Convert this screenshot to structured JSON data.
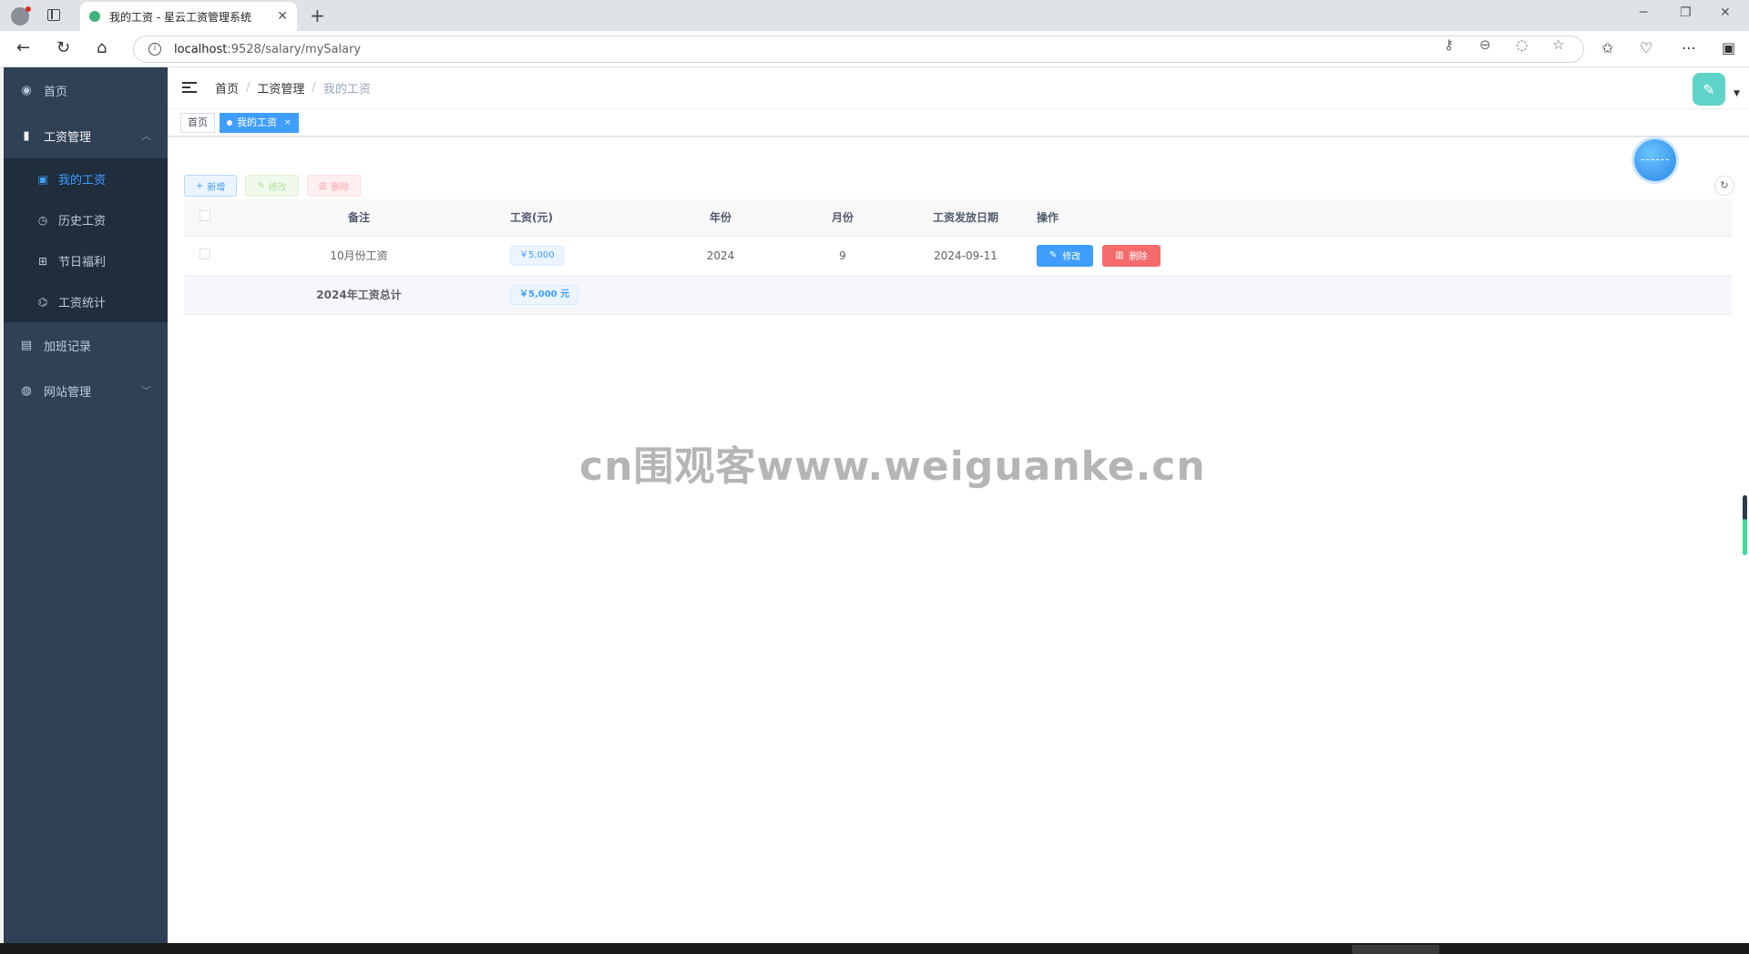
{
  "browser": {
    "tab_title": "我的工资 - 星云工资管理系统",
    "url_host": "localhost",
    "url_path": ":9528/salary/mySalary"
  },
  "sidebar": {
    "items": [
      {
        "label": "首页",
        "icon": "dashboard-icon"
      },
      {
        "label": "工资管理",
        "icon": "book-icon",
        "expanded": true,
        "children": [
          {
            "label": "我的工资",
            "icon": "money-icon",
            "active": true
          },
          {
            "label": "历史工资",
            "icon": "clock-icon"
          },
          {
            "label": "节日福利",
            "icon": "gift-icon"
          },
          {
            "label": "工资统计",
            "icon": "chart-icon"
          }
        ]
      },
      {
        "label": "加班记录",
        "icon": "calendar-icon"
      },
      {
        "label": "网站管理",
        "icon": "globe-icon",
        "expanded": false
      }
    ]
  },
  "breadcrumb": [
    "首页",
    "工资管理",
    "我的工资"
  ],
  "tags": [
    {
      "label": "首页",
      "active": false
    },
    {
      "label": "我的工资",
      "active": true
    }
  ],
  "toolbar": {
    "add_label": "新增",
    "edit_label": "修改",
    "delete_label": "删除"
  },
  "table": {
    "columns": [
      "备注",
      "工资(元)",
      "年份",
      "月份",
      "工资发放日期",
      "操作"
    ],
    "rows": [
      {
        "remark": "10月份工资",
        "salary": "￥5,000",
        "year": "2024",
        "month": "9",
        "pay_date": "2024-09-11"
      }
    ],
    "row_edit_label": "修改",
    "row_delete_label": "删除",
    "summary": {
      "label": "2024年工资总计",
      "total": "￥5,000 元"
    }
  },
  "watermark": "cn围观客www.weiguanke.cn",
  "colors": {
    "sidebar_bg": "#304156",
    "submenu_bg": "#1f2d3d",
    "primary": "#409eff",
    "danger": "#f56c6c"
  }
}
